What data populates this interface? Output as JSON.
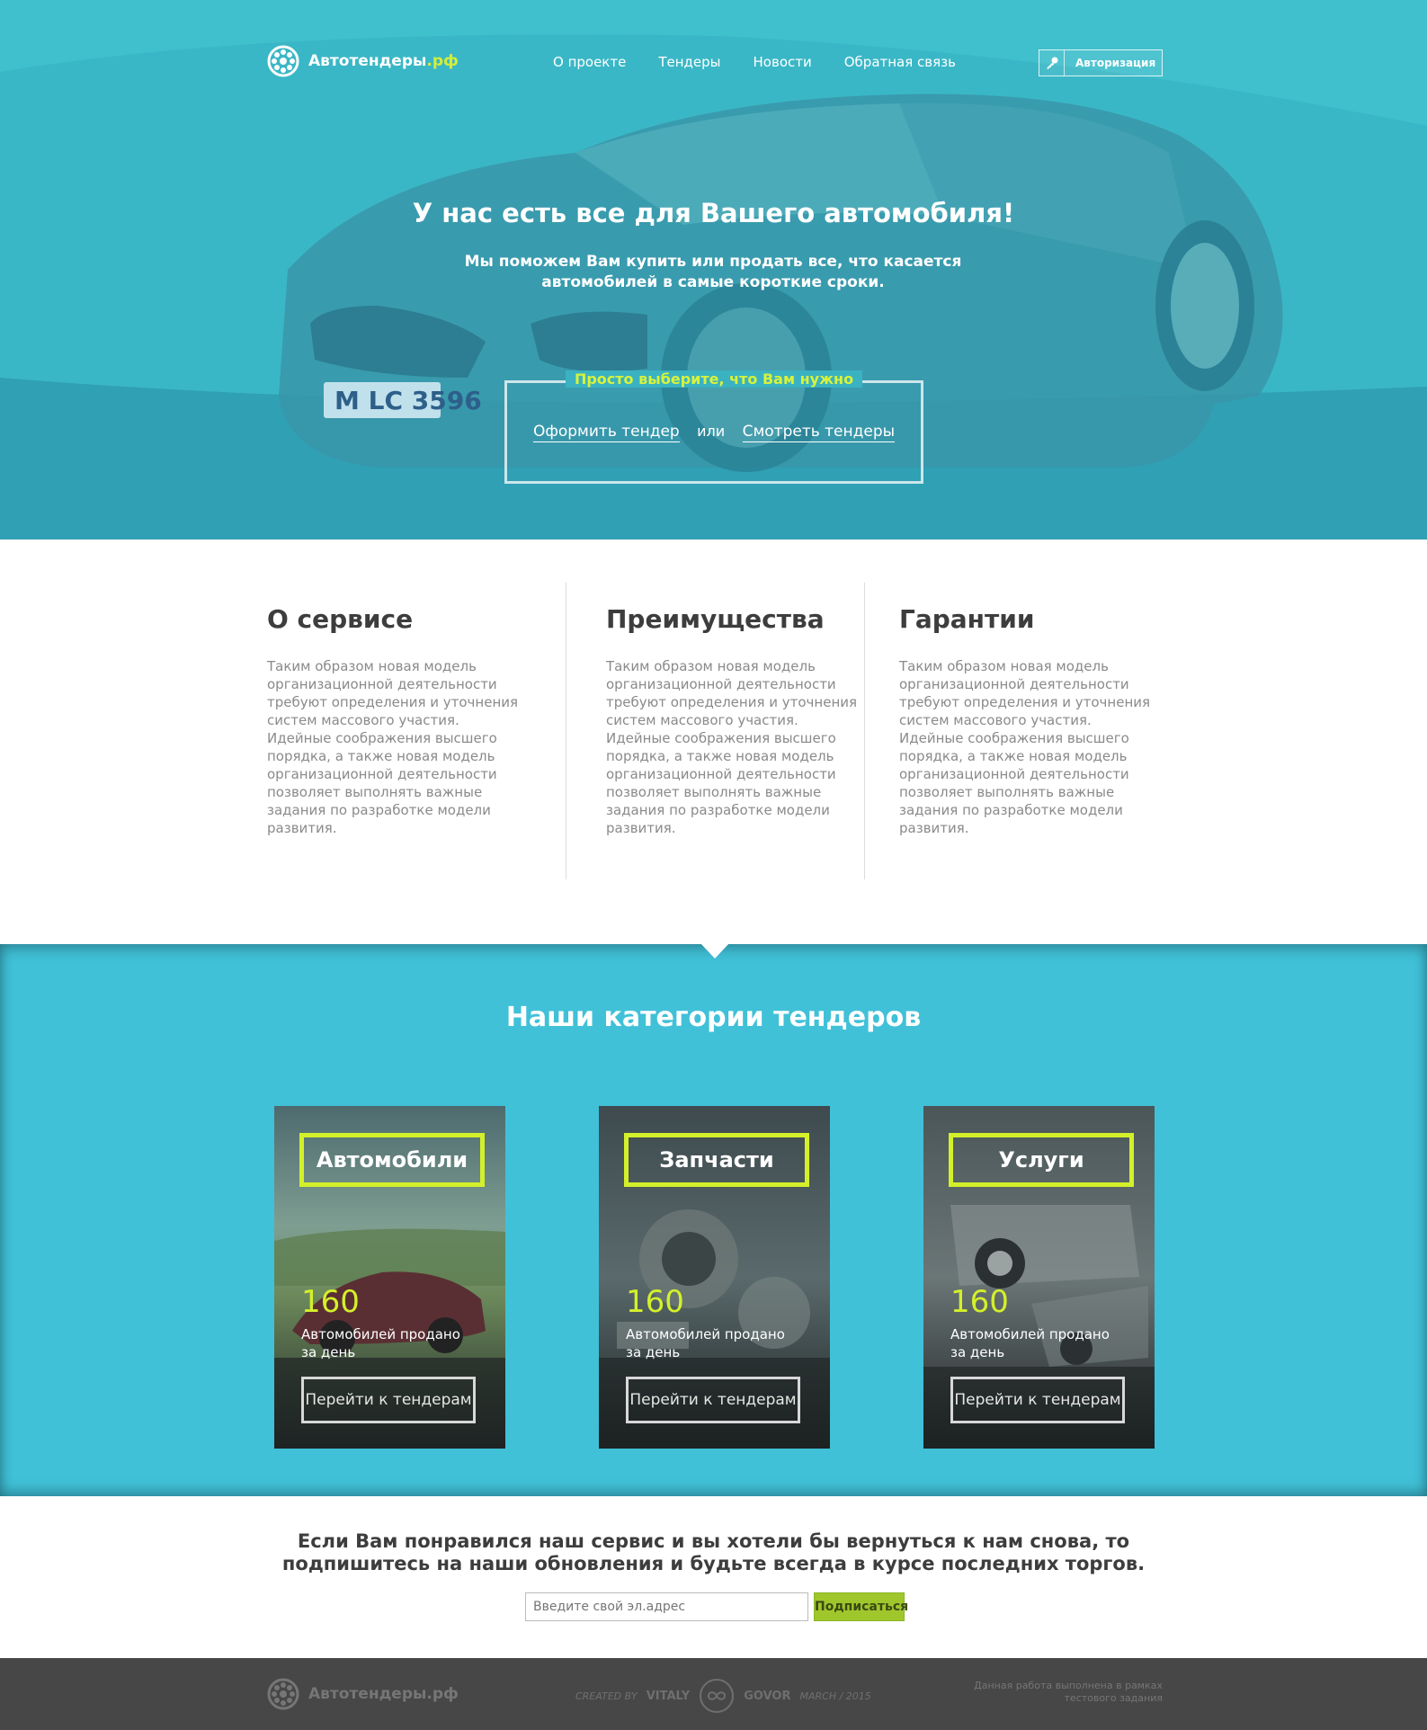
{
  "header": {
    "logo_text": "Автотендеры",
    "logo_suffix": ".рф",
    "nav": [
      "О проекте",
      "Тендеры",
      "Новости",
      "Обратная связь"
    ],
    "auth_label": "Авторизация"
  },
  "hero": {
    "title": "У нас есть все для Вашего автомобиля!",
    "subtitle": "Мы поможем Вам купить или продать все, что касается автомобилей в самые короткие сроки.",
    "choose_label": "Просто выберите, что Вам нужно",
    "link_create": "Оформить тендер",
    "link_or": "или",
    "link_view": "Смотреть тендеры",
    "plate_text": "M LC 3596"
  },
  "features": [
    {
      "title": "О сервисе",
      "text": "Таким образом новая модель организационной деятельности требуют определения и уточнения систем массового участия. Идейные соображения высшего порядка, а также новая модель организационной деятельности позволяет выполнять важные задания по разработке модели развития."
    },
    {
      "title": "Преимущества",
      "text": "Таким образом новая модель организационной деятельности требуют определения и уточнения систем массового участия. Идейные соображения высшего порядка, а также новая модель организационной деятельности позволяет выполнять важные задания по разработке модели развития."
    },
    {
      "title": "Гарантии",
      "text": "Таким образом новая модель организационной деятельности требуют определения и уточнения систем массового участия. Идейные соображения высшего порядка, а также новая модель организационной деятельности позволяет выполнять важные задания по разработке модели развития."
    }
  ],
  "categories": {
    "title": "Наши категории тендеров",
    "cards": [
      {
        "name": "Автомобили",
        "count": "160",
        "caption": "Автомобилей продано за день",
        "button": "Перейти к тендерам"
      },
      {
        "name": "Запчасти",
        "count": "160",
        "caption": "Автомобилей продано за день",
        "button": "Перейти к тендерам"
      },
      {
        "name": "Услуги",
        "count": "160",
        "caption": "Автомобилей продано за день",
        "button": "Перейти к тендерам"
      }
    ]
  },
  "subscribe": {
    "text": "Если Вам понравился наш сервис и вы хотели бы вернуться к нам снова, то подпишитесь на наши обновления и будьте всегда в курсе последних торгов.",
    "placeholder": "Введите свой эл.адрес",
    "button": "Подписаться"
  },
  "footer": {
    "logo_text": "Автотендеры.рф",
    "created_by": "CREATED BY",
    "author_first": "VITALY",
    "author_last": "GOVOR",
    "date": "MARCH / 2015",
    "note": "Данная работа выполнена в рамках тестового задания"
  },
  "colors": {
    "accent": "#d4f02a",
    "teal": "#40c1d8",
    "subscribe_button": "#9fc72c",
    "footer_bg": "#474747"
  }
}
